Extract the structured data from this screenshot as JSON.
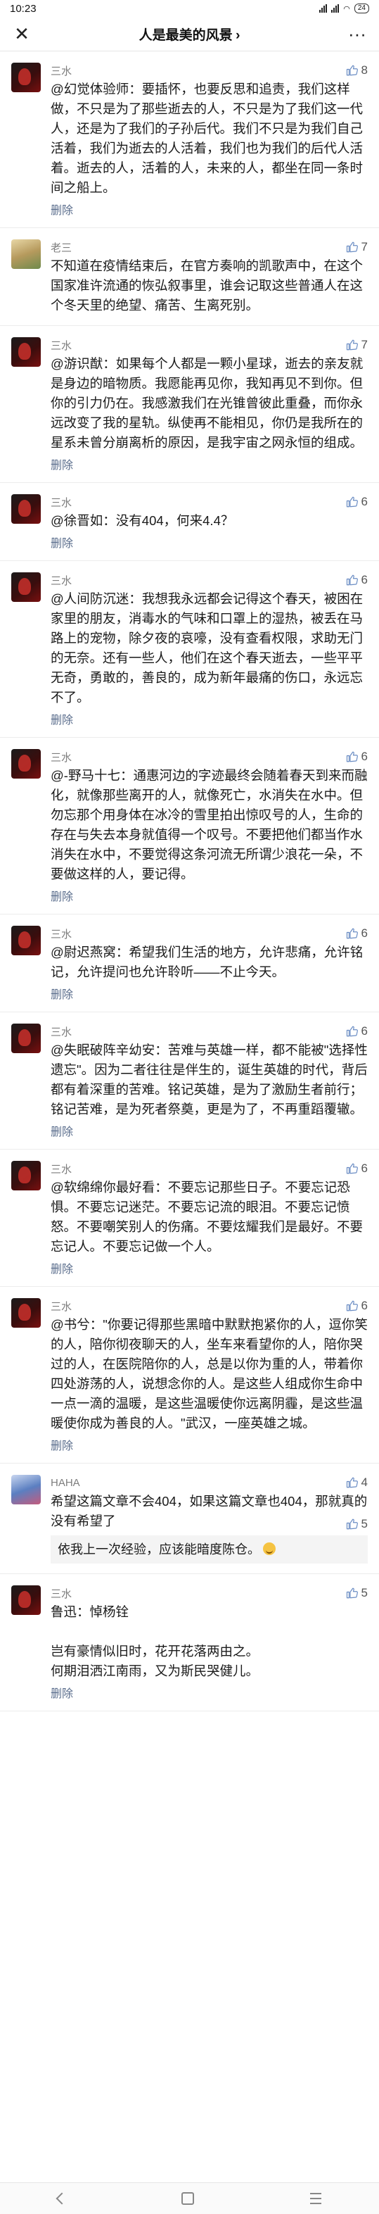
{
  "status_bar": {
    "time": "10:23",
    "battery": "24"
  },
  "nav": {
    "title": "人是最美的风景",
    "chevron": "›",
    "close_icon": "close-icon",
    "more_icon": "more-icon"
  },
  "comments": [
    {
      "author": "三水",
      "likes": "8",
      "avatar": "sanshui",
      "text": "@幻觉体验师：要插怀，也要反思和追责，我们这样做，不只是为了那些逝去的人，不只是为了我们这一代人，还是为了我们的子孙后代。我们不只是为我们自己活着，我们为逝去的人活着，我们也为我们的后代人活着。逝去的人，活着的人，未来的人，都坐在同一条时间之船上。",
      "delete": "删除"
    },
    {
      "author": "老三",
      "likes": "7",
      "avatar": "laosan",
      "text": "不知道在疫情结束后，在官方奏响的凯歌声中，在这个国家准许流通的恢弘叙事里，谁会记取这些普通人在这个冬天里的绝望、痛苦、生离死别。",
      "delete": ""
    },
    {
      "author": "三水",
      "likes": "7",
      "avatar": "sanshui",
      "text": "@游识猷：如果每个人都是一颗小星球，逝去的亲友就是身边的暗物质。我愿能再见你，我知再见不到你。但你的引力仍在。我感激我们在光锥曾彼此重叠，而你永远改变了我的星轨。纵使再不能相见，你仍是我所在的星系未曾分崩离析的原因，是我宇宙之网永恒的组成。",
      "delete": "删除"
    },
    {
      "author": "三水",
      "likes": "6",
      "avatar": "sanshui",
      "text": "@徐晋如：没有404，何来4.4？",
      "delete": "删除"
    },
    {
      "author": "三水",
      "likes": "6",
      "avatar": "sanshui",
      "text": "@人间防沉迷：我想我永远都会记得这个春天，被困在家里的朋友，消毒水的气味和口罩上的湿热，被丢在马路上的宠物，除夕夜的哀嚎，没有查看权限，求助无门的无奈。还有一些人，他们在这个春天逝去，一些平平无奇，勇敢的，善良的，成为新年最痛的伤口，永远忘不了。",
      "delete": "删除"
    },
    {
      "author": "三水",
      "likes": "6",
      "avatar": "sanshui",
      "text": "@-野马十七：通惠河边的字迹最终会随着春天到来而融化，就像那些离开的人，就像死亡，水消失在水中。但勿忘那个用身体在冰冷的雪里拍出惊叹号的人，生命的存在与失去本身就值得一个叹号。不要把他们都当作水消失在水中，不要觉得这条河流无所谓少浪花一朵，不要做这样的人，要记得。",
      "delete": "删除"
    },
    {
      "author": "三水",
      "likes": "6",
      "avatar": "sanshui",
      "text": "@尉迟燕窝：希望我们生活的地方，允许悲痛，允许铭记，允许提问也允许聆听——不止今天。",
      "delete": "删除"
    },
    {
      "author": "三水",
      "likes": "6",
      "avatar": "sanshui",
      "text": "@失眠破阵辛幼安：苦难与英雄一样，都不能被\"选择性遗忘\"。因为二者往往是伴生的，诞生英雄的时代，背后都有着深重的苦难。铭记英雄，是为了激励生者前行；铭记苦难，是为死者祭奠，更是为了，不再重蹈覆辙。",
      "delete": "删除"
    },
    {
      "author": "三水",
      "likes": "6",
      "avatar": "sanshui",
      "text": "@软绵绵你最好看：不要忘记那些日子。不要忘记恐惧。不要忘记迷茫。不要忘记流的眼泪。不要忘记愤怒。不要嘲笑别人的伤痛。不要炫耀我们是最好。不要忘记人。不要忘记做一个人。",
      "delete": "删除"
    },
    {
      "author": "三水",
      "likes": "6",
      "avatar": "sanshui",
      "text": "@书兮：\"你要记得那些黑暗中默默抱紧你的人，逗你笑的人，陪你彻夜聊天的人，坐车来看望你的人，陪你哭过的人，在医院陪你的人，总是以你为重的人，带着你四处游荡的人，说想念你的人。是这些人组成你生命中一点一滴的温暖，是这些温暖使你远离阴霾，是这些温暖使你成为善良的人。\"武汉，一座英雄之城。",
      "delete": "删除"
    },
    {
      "author": "HAHA",
      "likes": "4",
      "avatar": "haha",
      "text": "希望这篇文章不会404，如果这篇文章也404，那就真的没有希望了",
      "delete": "",
      "reply": {
        "text": "依我上一次经验，应该能暗度陈仓。",
        "likes": "5"
      }
    },
    {
      "author": "三水",
      "likes": "5",
      "avatar": "sanshui",
      "text": "鲁迅：悼杨铨\n\n岂有豪情似旧时，花开花落两由之。\n何期泪洒江南雨，又为斯民哭健儿。",
      "delete": "删除"
    }
  ]
}
